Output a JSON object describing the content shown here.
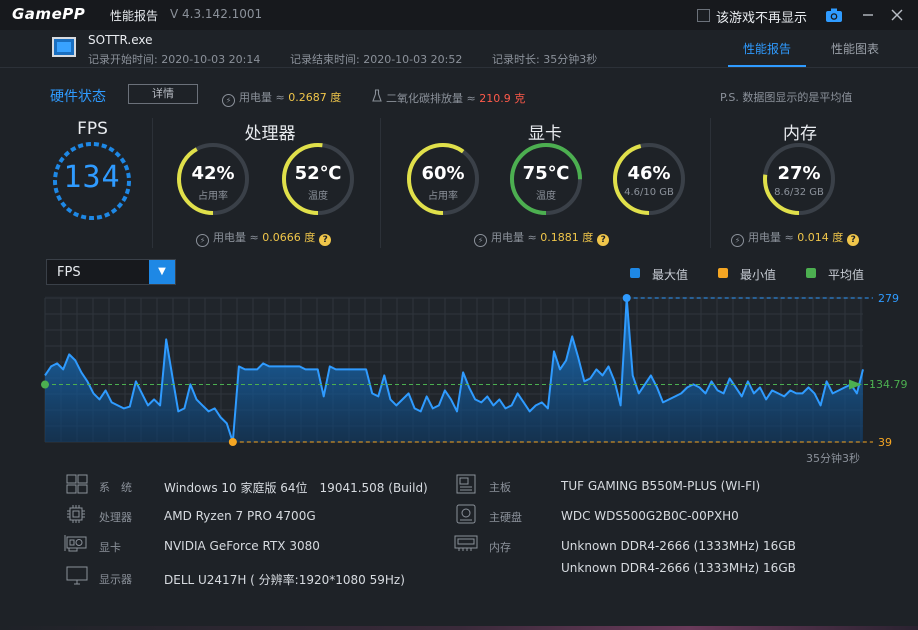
{
  "titlebar": {
    "logo_a": "Game",
    "logo_b": "PP",
    "app_title": "性能报告",
    "version": "V 4.3.142.1001",
    "no_remind_label": "该游戏不再显示"
  },
  "header": {
    "exe_name": "SOTTR.exe",
    "start_time": "记录开始时间: 2020-10-03 20:14",
    "end_time": "记录结束时间: 2020-10-03 20:52",
    "duration": "记录时长: 35分钟3秒",
    "tabs": [
      {
        "label": "性能报告",
        "active": true
      },
      {
        "label": "性能图表",
        "active": false
      }
    ]
  },
  "hardware": {
    "title": "硬件状态",
    "detail_button": "详情",
    "power_label": "用电量 ≈",
    "power_value": "0.2687 度",
    "co2_label": "二氧化碳排放量 ≈",
    "co2_value": "210.9 克",
    "note": "P.S. 数据图显示的是平均值"
  },
  "fps": {
    "title": "FPS",
    "value": "134"
  },
  "cpu": {
    "title": "处理器",
    "usage_value": "42%",
    "usage_label": "占用率",
    "usage_pct": 42,
    "temp_value": "52℃",
    "temp_label": "温度",
    "temp_pct": 52,
    "power_label": "用电量 ≈",
    "power_value": "0.0666 度"
  },
  "gpu": {
    "title": "显卡",
    "usage_value": "60%",
    "usage_label": "占用率",
    "usage_pct": 60,
    "temp_value": "75℃",
    "temp_label": "温度",
    "temp_pct": 75,
    "vram_value": "46%",
    "vram_label": "4.6/10 GB",
    "vram_pct": 46,
    "power_label": "用电量 ≈",
    "power_value": "0.1881 度"
  },
  "memory": {
    "title": "内存",
    "usage_value": "27%",
    "usage_label": "8.6/32 GB",
    "usage_pct": 27,
    "power_label": "用电量 ≈",
    "power_value": "0.014 度"
  },
  "chart": {
    "selector": "FPS",
    "legend": [
      {
        "label": "最大值",
        "color": "#1e88e5"
      },
      {
        "label": "最小值",
        "color": "#f5a623"
      },
      {
        "label": "平均值",
        "color": "#4caf50"
      }
    ],
    "max_label": "279",
    "avg_label": "134.79",
    "min_label": "39",
    "duration_label": "35分钟3秒"
  },
  "chart_data": {
    "type": "area",
    "series": [
      {
        "values": [
          150,
          165,
          170,
          160,
          185,
          175,
          155,
          140,
          120,
          110,
          125,
          105,
          100,
          95,
          98,
          140,
          120,
          100,
          110,
          100,
          210,
          150,
          90,
          95,
          135,
          110,
          100,
          90,
          95,
          80,
          70,
          39,
          165,
          160,
          160,
          160,
          170,
          165,
          165,
          165,
          165,
          165,
          165,
          160,
          160,
          160,
          115,
          165,
          160,
          160,
          160,
          160,
          160,
          160,
          120,
          115,
          150,
          110,
          100,
          110,
          120,
          95,
          90,
          115,
          95,
          100,
          125,
          110,
          90,
          155,
          130,
          110,
          105,
          115,
          100,
          110,
          95,
          100,
          120,
          105,
          90,
          100,
          105,
          95,
          190,
          160,
          175,
          215,
          180,
          140,
          145,
          160,
          150,
          165,
          140,
          100,
          279,
          150,
          120,
          135,
          150,
          130,
          105,
          110,
          115,
          120,
          130,
          135,
          130,
          120,
          140,
          125,
          120,
          145,
          130,
          115,
          140,
          120,
          130,
          110,
          125,
          120,
          115,
          125,
          120,
          120,
          130,
          120,
          100,
          140,
          120,
          125,
          130,
          135,
          120,
          160
        ]
      }
    ],
    "max": 279,
    "min": 39,
    "avg": 134.79,
    "ylim": [
      39,
      279
    ]
  },
  "system_info": {
    "left": [
      {
        "icon": "windows-icon",
        "key": "系　统",
        "value": "Windows 10 家庭版 64位　19041.508 (Build)"
      },
      {
        "icon": "cpu-chip-icon",
        "key": "处理器",
        "value": "AMD Ryzen 7 PRO 4700G"
      },
      {
        "icon": "graphics-card-icon",
        "key": "显卡",
        "value": "NVIDIA GeForce RTX 3080"
      },
      {
        "icon": "monitor-icon",
        "key": "显示器",
        "value": "DELL U2417H ( 分辨率:1920*1080 59Hz)"
      }
    ],
    "right": [
      {
        "icon": "motherboard-icon",
        "key": "主板",
        "value": "TUF GAMING B550M-PLUS (WI-FI)"
      },
      {
        "icon": "hard-disk-icon",
        "key": "主硬盘",
        "value": "WDC WDS500G2B0C-00PXH0"
      },
      {
        "icon": "memory-module-icon",
        "key": "内存",
        "value": "Unknown DDR4-2666 (1333MHz) 16GB"
      },
      {
        "icon": "",
        "key": "",
        "value": "Unknown DDR4-2666 (1333MHz) 16GB"
      }
    ]
  }
}
